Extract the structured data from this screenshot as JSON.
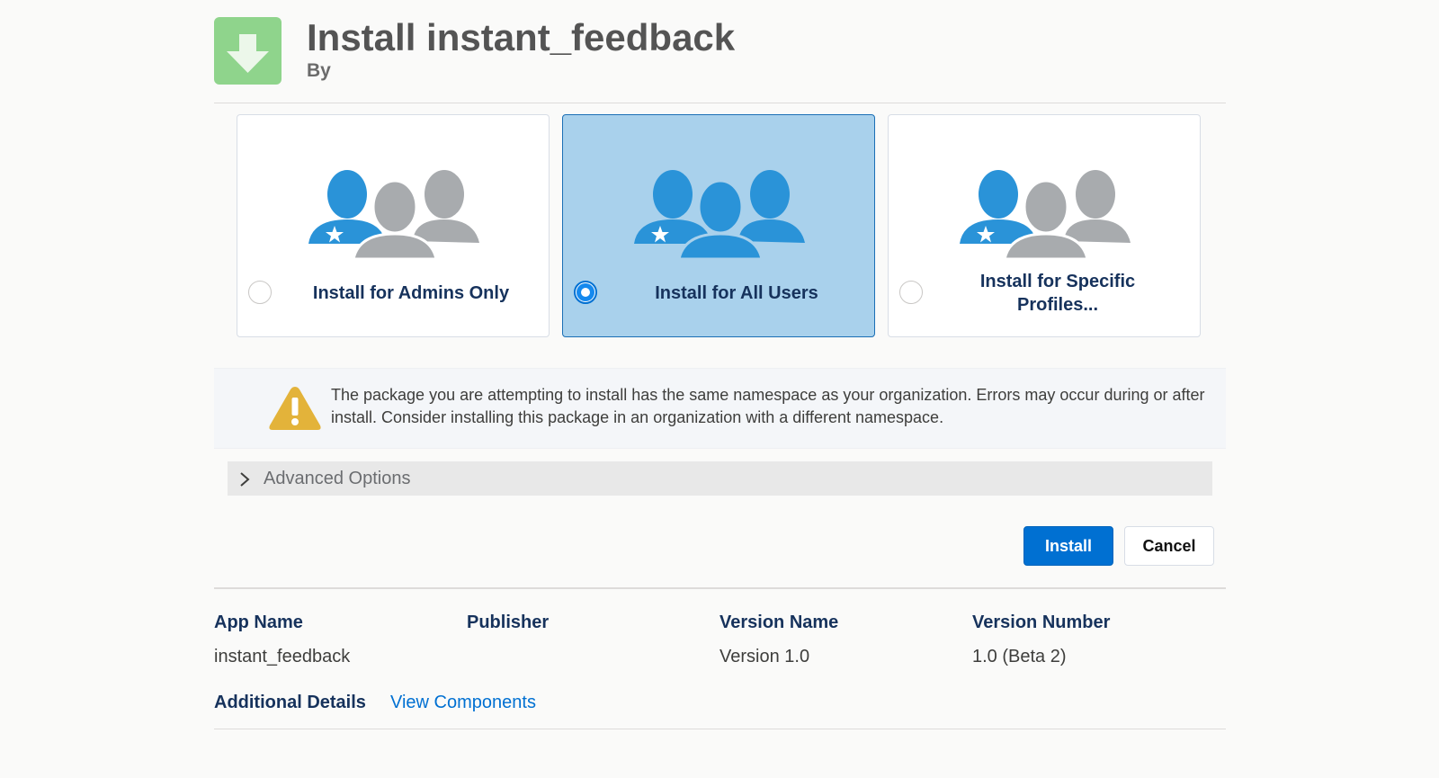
{
  "header": {
    "title": "Install instant_feedback",
    "by_label": "By",
    "icon": "download-arrow-icon"
  },
  "install_options": [
    {
      "label": "Install for Admins Only",
      "selected": false
    },
    {
      "label": "Install for All Users",
      "selected": true
    },
    {
      "label": "Install for Specific Profiles...",
      "selected": false
    }
  ],
  "warning": {
    "icon": "warning-triangle-icon",
    "text": "The package you are attempting to install has the same namespace as your organization. Errors may occur during or after install. Consider installing this package in an organization with a different namespace."
  },
  "advanced": {
    "label": "Advanced Options",
    "icon": "chevron-right-icon"
  },
  "buttons": {
    "install": "Install",
    "cancel": "Cancel"
  },
  "details": {
    "app_name_label": "App Name",
    "app_name_value": "instant_feedback",
    "publisher_label": "Publisher",
    "publisher_value": "",
    "version_name_label": "Version Name",
    "version_name_value": "Version 1.0",
    "version_number_label": "Version Number",
    "version_number_value": "1.0 (Beta 2)",
    "additional_details_label": "Additional Details",
    "view_components_link": "View Components"
  },
  "colors": {
    "primary": "#0070d2",
    "selected_bg": "#a9d1ec",
    "user_blue": "#2a93d8",
    "user_gray": "#a8abae",
    "warning": "#e3b33a",
    "app_icon": "#8fd48c"
  }
}
